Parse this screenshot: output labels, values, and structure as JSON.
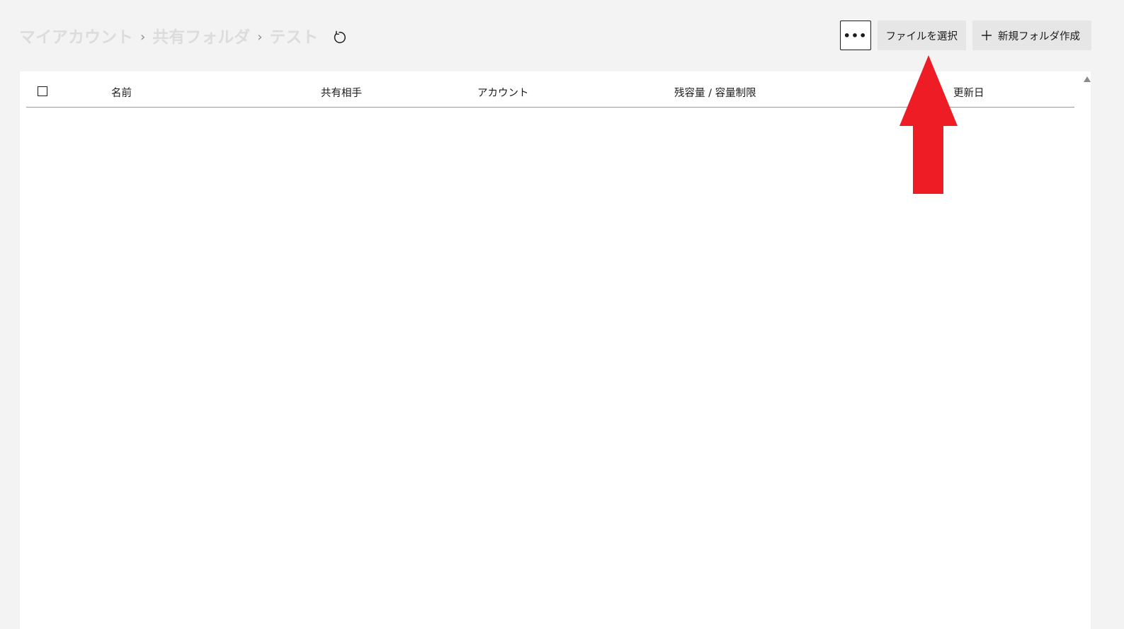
{
  "breadcrumb": {
    "items": [
      "マイアカウント",
      "共有フォルダ",
      "テスト"
    ],
    "separator": "›"
  },
  "toolbar": {
    "more_label": "•••",
    "select_file_label": "ファイルを選択",
    "new_folder_label": "新規フォルダ作成"
  },
  "table": {
    "columns": [
      "名前",
      "共有相手",
      "アカウント",
      "残容量 / 容量制限",
      "更新日"
    ],
    "rows": []
  },
  "icons": {
    "refresh": "refresh-icon",
    "plus": "plus-icon",
    "scroll_up": "triangle-up-icon",
    "annotation": "red-arrow-up-icon"
  },
  "colors": {
    "background": "#f3f3f3",
    "panel": "#ffffff",
    "button": "#e6e6e6",
    "annotation": "#ee1c25"
  }
}
